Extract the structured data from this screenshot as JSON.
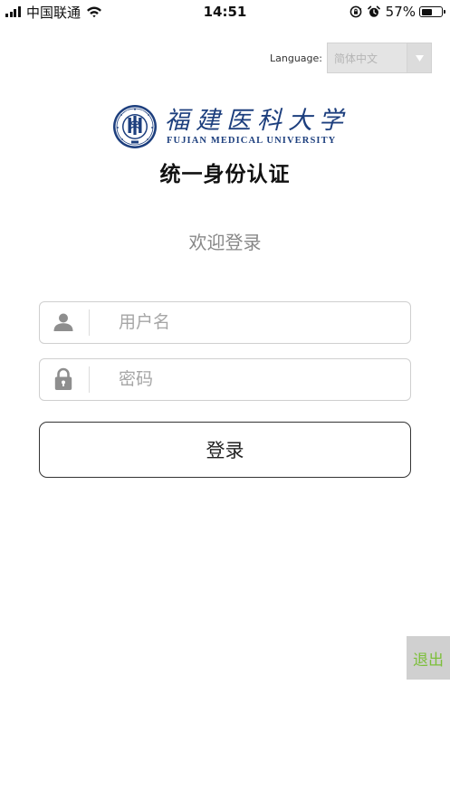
{
  "status_bar": {
    "carrier": "中国联通",
    "time": "14:51",
    "battery_percent": "57%",
    "battery_level": 0.57,
    "icons": [
      "signal-icon",
      "wifi-icon",
      "rotation-lock-icon",
      "alarm-icon",
      "battery-icon"
    ]
  },
  "language": {
    "label": "Language:",
    "selected": "简体中文",
    "arrow_icon": "chevron-down-icon"
  },
  "logo": {
    "name_cn": "福建医科大学",
    "name_en": "FUJIAN MEDICAL UNIVERSITY",
    "subtitle": "统一身份认证"
  },
  "welcome": "欢迎登录",
  "form": {
    "username": {
      "placeholder": "用户名",
      "value": "",
      "icon": "user-icon"
    },
    "password": {
      "placeholder": "密码",
      "value": "",
      "icon": "lock-icon"
    },
    "submit_label": "登录"
  },
  "exit_label": "退出",
  "colors": {
    "brand_blue": "#1d3f7e",
    "exit_text": "#7cbf3a",
    "exit_bg": "#d0d0d0",
    "placeholder": "#a6a6a6",
    "welcome_text": "#888888"
  }
}
